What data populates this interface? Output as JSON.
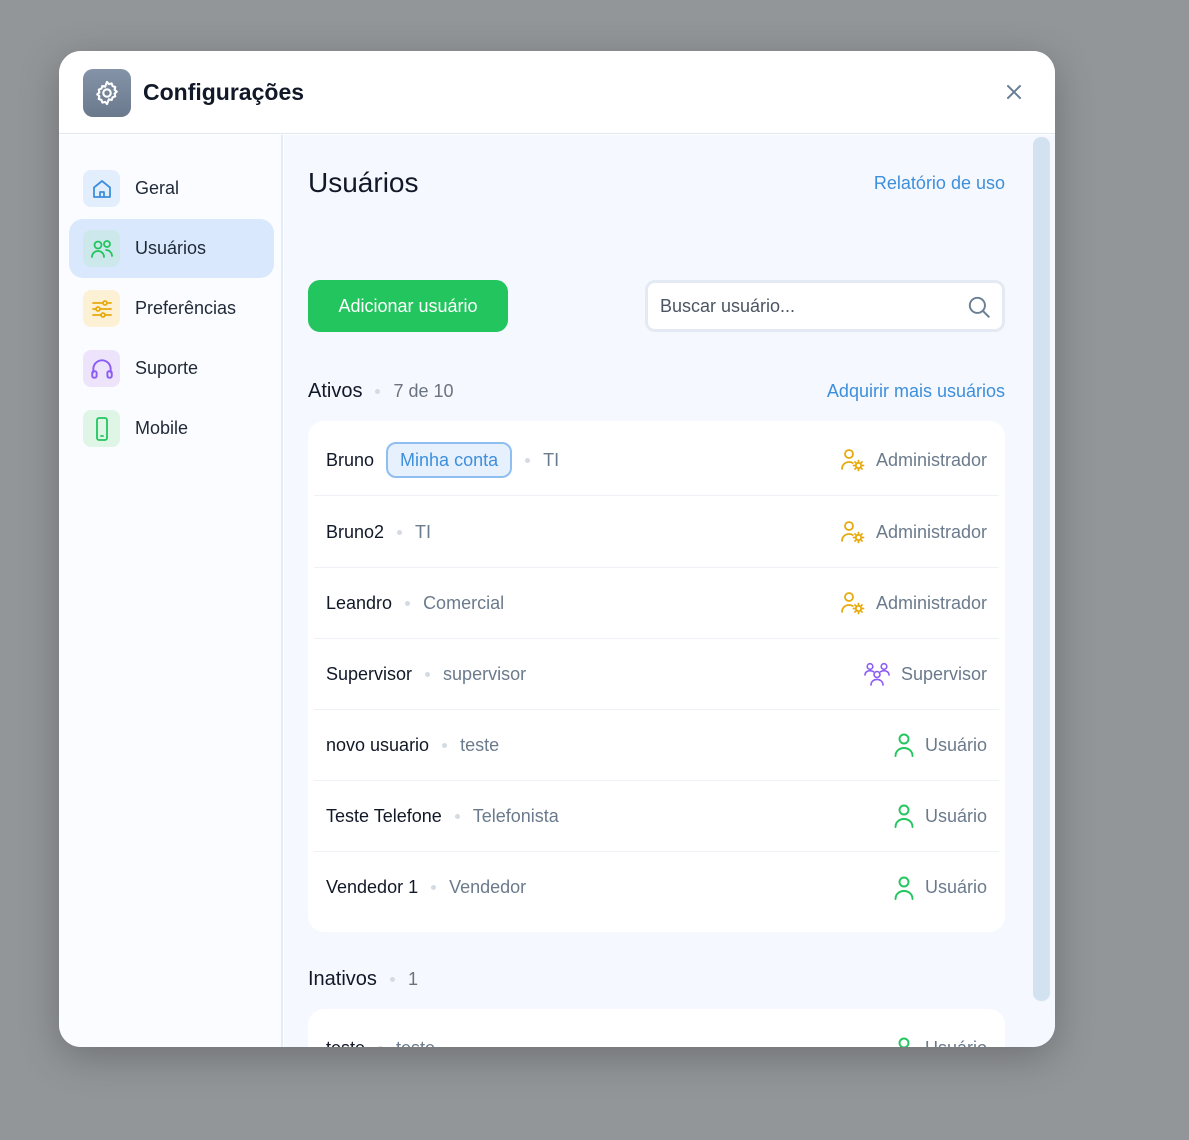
{
  "window": {
    "title": "Configurações",
    "close_icon": "close-icon"
  },
  "sidebar": {
    "items": [
      {
        "label": "Geral",
        "icon": "home-icon",
        "color": "#3d8fdc",
        "bg": "#e3eefc"
      },
      {
        "label": "Usuários",
        "icon": "users-icon",
        "color": "#22c55e",
        "bg": "#cde8ea",
        "active": true
      },
      {
        "label": "Preferências",
        "icon": "sliders-icon",
        "color": "#e8a90c",
        "bg": "#fdf1d5"
      },
      {
        "label": "Suporte",
        "icon": "headphones-icon",
        "color": "#8b5cf6",
        "bg": "#ede4fb"
      },
      {
        "label": "Mobile",
        "icon": "smartphone-icon",
        "color": "#22c55e",
        "bg": "#dff5e5"
      }
    ]
  },
  "main": {
    "title": "Usuários",
    "usage_report_link": "Relatório de uso",
    "add_user_label": "Adicionar usuário",
    "search": {
      "placeholder": "Buscar usuário...",
      "value": ""
    },
    "active": {
      "title": "Ativos",
      "count": "7 de 10",
      "buy_more_link": "Adquirir mais usuários",
      "users": [
        {
          "name": "Bruno",
          "badge": "Minha conta",
          "dept": "TI",
          "role": "Administrador",
          "role_icon": "admin-icon"
        },
        {
          "name": "Bruno2",
          "dept": "TI",
          "role": "Administrador",
          "role_icon": "admin-icon"
        },
        {
          "name": "Leandro",
          "dept": "Comercial",
          "role": "Administrador",
          "role_icon": "admin-icon"
        },
        {
          "name": "Supervisor",
          "dept": "supervisor",
          "role": "Supervisor",
          "role_icon": "supervisor-icon"
        },
        {
          "name": "novo usuario",
          "dept": "teste",
          "role": "Usuário",
          "role_icon": "user-icon"
        },
        {
          "name": "Teste Telefone",
          "dept": "Telefonista",
          "role": "Usuário",
          "role_icon": "user-icon"
        },
        {
          "name": "Vendedor 1",
          "dept": "Vendedor",
          "role": "Usuário",
          "role_icon": "user-icon"
        }
      ]
    },
    "inactive": {
      "title": "Inativos",
      "count": "1",
      "users": [
        {
          "name": "teste",
          "dept": "teste",
          "role": "Usuário",
          "role_icon": "user-icon"
        }
      ]
    }
  },
  "colors": {
    "accent_green": "#22c55e",
    "link_blue": "#3d8fdc",
    "admin_gold": "#e8a90c",
    "supervisor_purple": "#8b5cf6"
  }
}
